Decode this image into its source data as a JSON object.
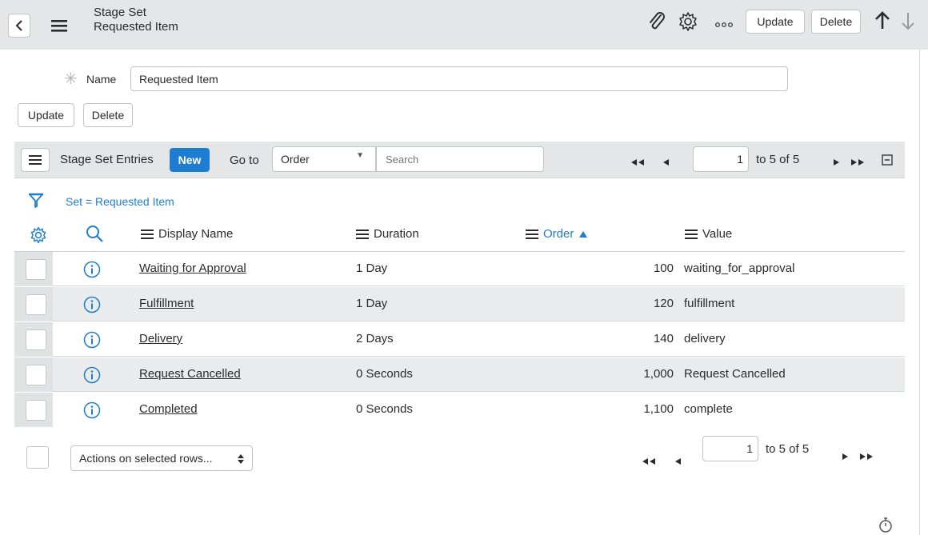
{
  "header": {
    "title": "Stage Set",
    "subtitle": "Requested Item",
    "update_label": "Update",
    "delete_label": "Delete"
  },
  "form": {
    "name_label": "Name",
    "name_value": "Requested Item",
    "update_label": "Update",
    "delete_label": "Delete"
  },
  "list": {
    "title": "Stage Set Entries",
    "new_label": "New",
    "goto_label": "Go to",
    "goto_selected": "Order",
    "search_placeholder": "Search",
    "page_value": "1",
    "page_total": "to 5 of 5",
    "filter_text": "Set = Requested Item",
    "columns": {
      "display_name": "Display Name",
      "duration": "Duration",
      "order": "Order",
      "value": "Value"
    },
    "rows": [
      {
        "display_name": "Waiting for Approval",
        "duration": "1 Day",
        "order": "100",
        "value": "waiting_for_approval"
      },
      {
        "display_name": "Fulfillment",
        "duration": "1 Day",
        "order": "120",
        "value": "fulfillment"
      },
      {
        "display_name": "Delivery",
        "duration": "2 Days",
        "order": "140",
        "value": "delivery"
      },
      {
        "display_name": "Request Cancelled",
        "duration": "0 Seconds",
        "order": "1,000",
        "value": "Request Cancelled"
      },
      {
        "display_name": "Completed",
        "duration": "0 Seconds",
        "order": "1,100",
        "value": "complete"
      }
    ]
  },
  "footer": {
    "actions_label": "Actions on selected rows...",
    "page_value": "1",
    "page_total": "to 5 of 5"
  },
  "colors": {
    "accent": "#1f7dd1",
    "header_bg": "#e4e6e7",
    "row_alt": "#e9ebec"
  }
}
